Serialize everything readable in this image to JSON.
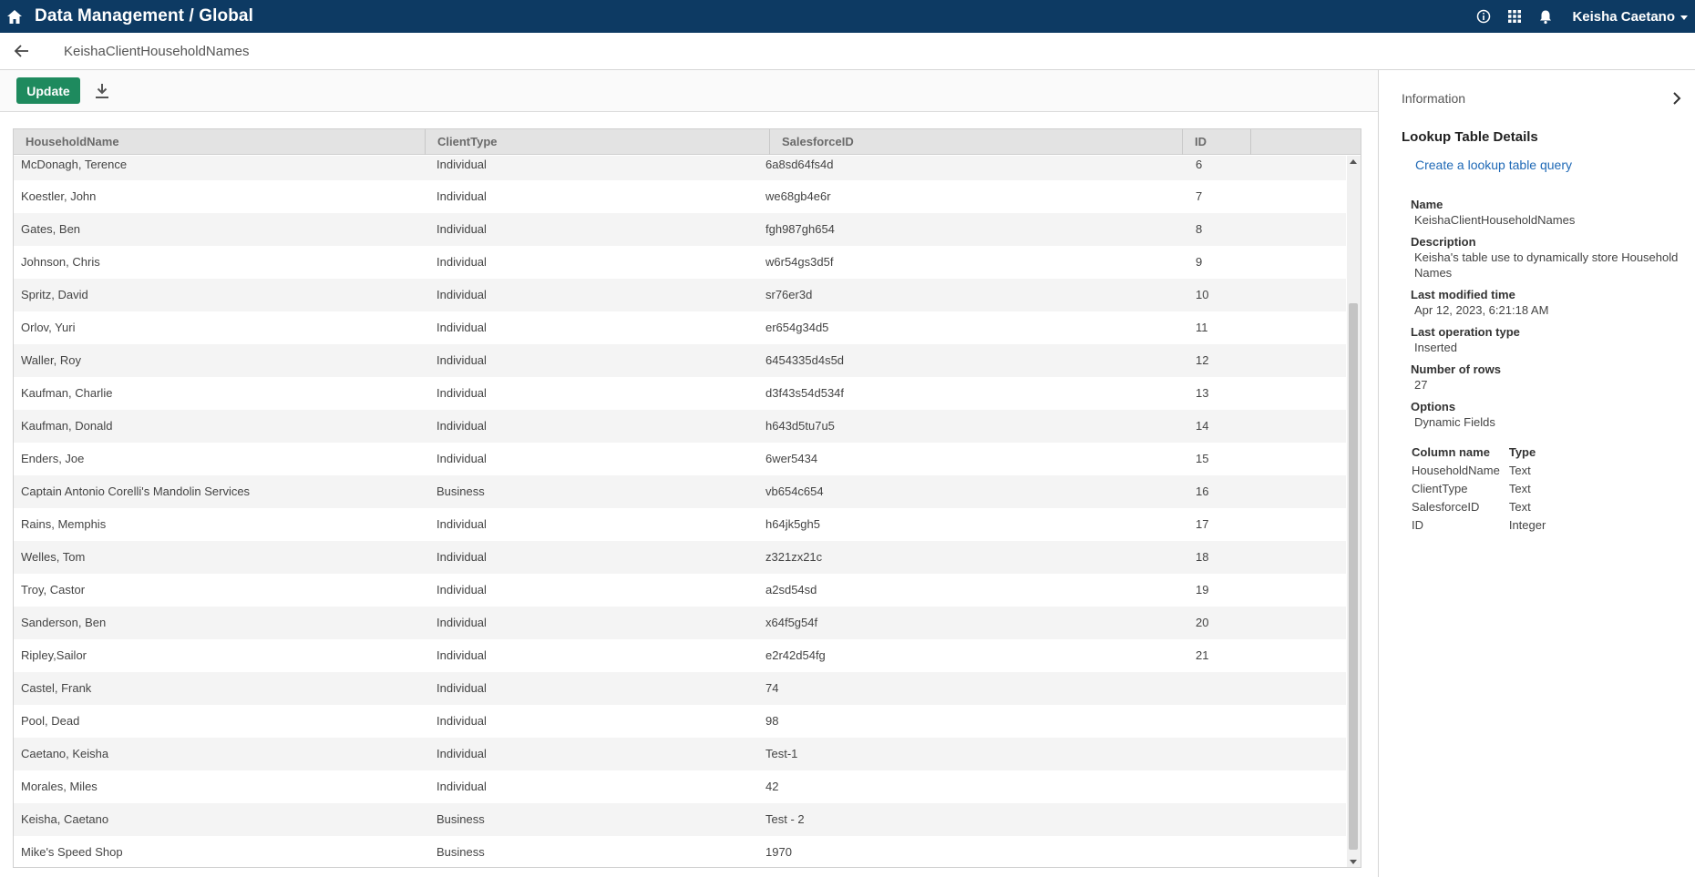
{
  "header": {
    "app_title": "Data Management / Global",
    "user_name": "Keisha Caetano"
  },
  "subheader": {
    "table_name": "KeishaClientHouseholdNames"
  },
  "toolbar": {
    "update_label": "Update"
  },
  "grid": {
    "columns": [
      "HouseholdName",
      "ClientType",
      "SalesforceID",
      "ID"
    ],
    "rows": [
      [
        "McDonagh, Terence",
        "Individual",
        "6a8sd64fs4d",
        "6"
      ],
      [
        "Koestler, John",
        "Individual",
        "we68gb4e6r",
        "7"
      ],
      [
        "Gates, Ben",
        "Individual",
        "fgh987gh654",
        "8"
      ],
      [
        "Johnson, Chris",
        "Individual",
        "w6r54gs3d5f",
        "9"
      ],
      [
        "Spritz, David",
        "Individual",
        "sr76er3d",
        "10"
      ],
      [
        "Orlov, Yuri",
        "Individual",
        "er654g34d5",
        "11"
      ],
      [
        "Waller, Roy",
        "Individual",
        "6454335d4s5d",
        "12"
      ],
      [
        "Kaufman, Charlie",
        "Individual",
        "d3f43s54d534f",
        "13"
      ],
      [
        "Kaufman, Donald",
        "Individual",
        "h643d5tu7u5",
        "14"
      ],
      [
        "Enders, Joe",
        "Individual",
        "6wer5434",
        "15"
      ],
      [
        "Captain Antonio Corelli's Mandolin Services",
        "Business",
        "vb654c654",
        "16"
      ],
      [
        "Rains, Memphis",
        "Individual",
        "h64jk5gh5",
        "17"
      ],
      [
        "Welles, Tom",
        "Individual",
        "z321zx21c",
        "18"
      ],
      [
        "Troy, Castor",
        "Individual",
        "a2sd54sd",
        "19"
      ],
      [
        "Sanderson, Ben",
        "Individual",
        "x64f5g54f",
        "20"
      ],
      [
        "Ripley,Sailor",
        "Individual",
        "e2r42d54fg",
        "21"
      ],
      [
        "Castel, Frank",
        "Individual",
        "74",
        ""
      ],
      [
        "Pool, Dead",
        "Individual",
        "98",
        ""
      ],
      [
        "Caetano, Keisha",
        "Individual",
        "Test-1",
        ""
      ],
      [
        "Morales, Miles",
        "Individual",
        "42",
        ""
      ],
      [
        "Keisha, Caetano",
        "Business",
        "Test - 2",
        ""
      ],
      [
        "Mike's Speed Shop",
        "Business",
        "1970",
        ""
      ]
    ]
  },
  "panel": {
    "info_label": "Information",
    "section_title": "Lookup Table Details",
    "query_link": "Create a lookup table query",
    "details": [
      {
        "label": "Name",
        "value": "KeishaClientHouseholdNames"
      },
      {
        "label": "Description",
        "value": "Keisha's table use to dynamically store Household Names"
      },
      {
        "label": "Last modified time",
        "value": "Apr 12, 2023, 6:21:18 AM"
      },
      {
        "label": "Last operation type",
        "value": "Inserted"
      },
      {
        "label": "Number of rows",
        "value": "27"
      },
      {
        "label": "Options",
        "value": "Dynamic Fields"
      }
    ],
    "column_table": {
      "headers": [
        "Column name",
        "Type"
      ],
      "rows": [
        [
          "HouseholdName",
          "Text"
        ],
        [
          "ClientType",
          "Text"
        ],
        [
          "SalesforceID",
          "Text"
        ],
        [
          "ID",
          "Integer"
        ]
      ]
    }
  },
  "icons": {
    "home": "home-icon",
    "info": "info-icon",
    "apps": "apps-grid-icon",
    "bell": "bell-icon",
    "back": "back-arrow-icon",
    "download": "download-icon",
    "chevron": "chevron-right-icon"
  },
  "colors": {
    "topbar": "#0d3a63",
    "update_button": "#1e8a5e",
    "link": "#1f69b6"
  }
}
